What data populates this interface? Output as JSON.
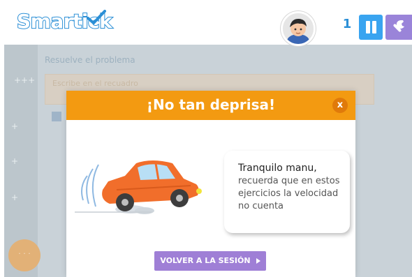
{
  "app": {
    "logo_text": "Smartick",
    "user_count": "1"
  },
  "icons": {
    "logo_check": "checkmark-icon",
    "avatar": "boy-avatar-icon",
    "pause": "pause-icon",
    "settings": "wrench-icon",
    "close": "close-icon",
    "car": "car-illustration",
    "play_arrow": "play-arrow-icon"
  },
  "background": {
    "instruction": "Resuelve el problema",
    "panel_text": "Escribe en el recuadro",
    "rail_marks": [
      "+++",
      "+",
      "+",
      "+"
    ],
    "help_dots": ". . ."
  },
  "modal": {
    "title": "¡No tan deprisa!",
    "close_label": "x",
    "message_first": "Tranquilo manu,",
    "message_rest": "recuerda que en estos ejercicios la velocidad no cuenta",
    "button_label": "VOLVER A LA SESIÓN"
  },
  "colors": {
    "brand_blue": "#2b8fd6",
    "header_orange": "#f39a11",
    "button_purple": "#9f7fd6",
    "pause_blue": "#39a4f0",
    "settings_purple": "#9a84d9"
  }
}
